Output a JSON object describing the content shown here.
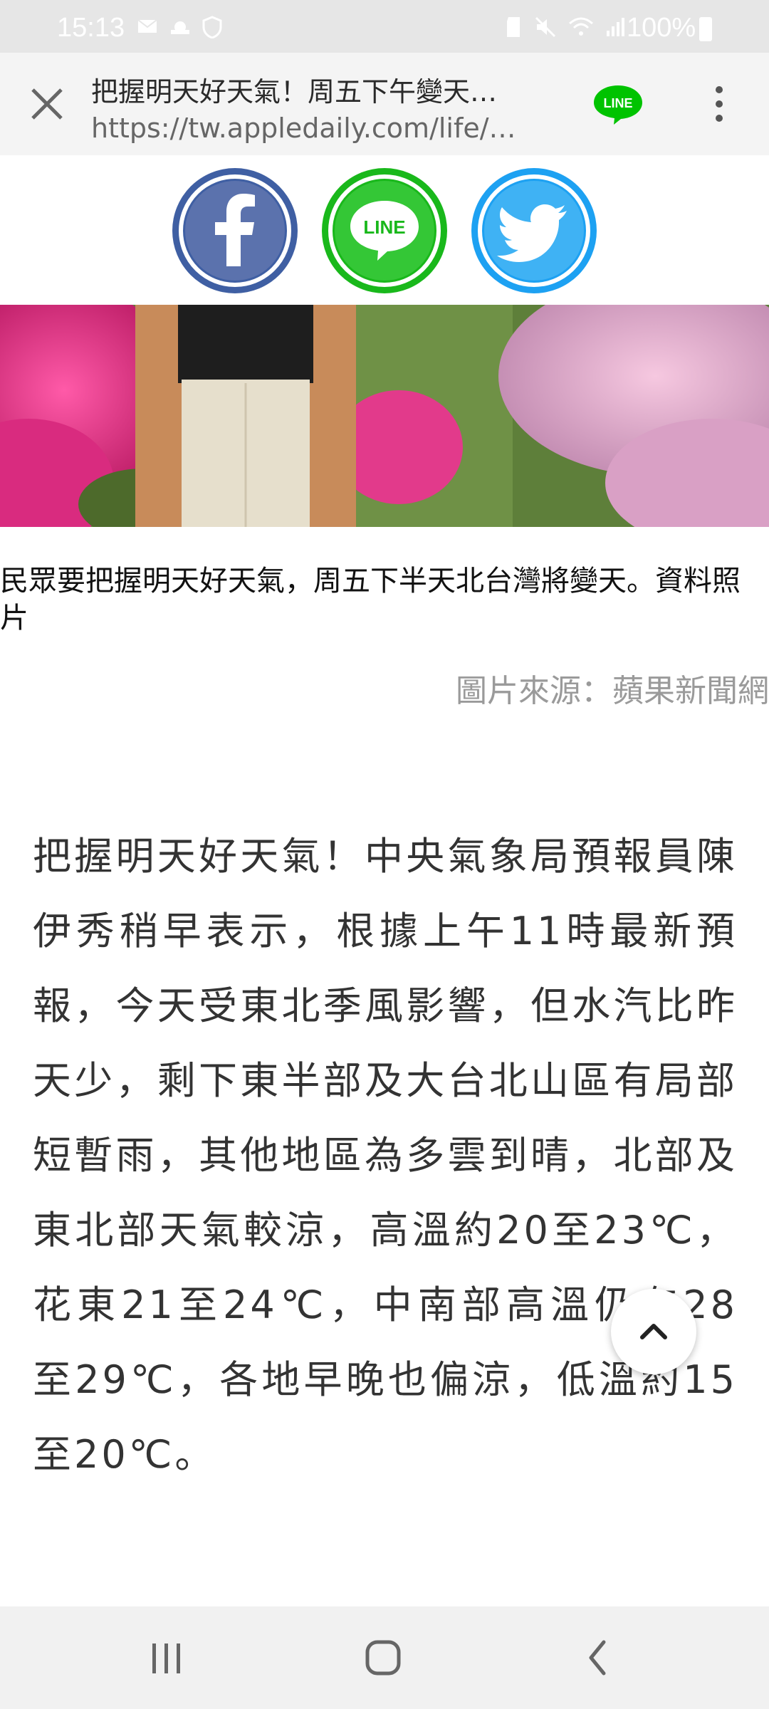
{
  "status_bar": {
    "time": "15:13",
    "battery_percent": "100%",
    "icons_left": [
      "mail-icon",
      "weather-icon",
      "shield-icon"
    ],
    "icons_right": [
      "sd-card-icon",
      "mute-icon",
      "wifi-icon",
      "signal-icon",
      "battery-icon"
    ]
  },
  "browser": {
    "title": "把握明天好天氣！周五下午變天…",
    "url": "https://tw.appledaily.com/life/…",
    "logo_text": "LINE",
    "close_icon": "close-icon",
    "more_icon": "more-vertical-icon"
  },
  "share": {
    "items": [
      {
        "name": "facebook",
        "glyph": "f",
        "color": "#3b5998"
      },
      {
        "name": "line",
        "glyph": "LINE",
        "color": "#00c300"
      },
      {
        "name": "twitter",
        "glyph": "bird",
        "color": "#1da1f2"
      }
    ]
  },
  "photo": {
    "alt_colors": {
      "flowers": "#e0338a",
      "grass": "#5e7f3a",
      "coat": "#c58a5a"
    }
  },
  "caption": {
    "text": "民眾要把握明天好天氣，周五下半天北台灣將變天。資料照片",
    "credit": "圖片來源：蘋果新聞網"
  },
  "article": {
    "paragraph": "把握明天好天氣！中央氣象局預報員陳伊秀稍早表示，根據上午11時最新預報，今天受東北季風影響，但水汽比昨天少，剩下東半部及大台北山區有局部短暫雨，其他地區為多雲到晴，北部及東北部天氣較涼，高溫約20至23℃，花東21至24℃，中南部高溫仍有28至29℃，各地早晚也偏涼，低溫約15至20℃。"
  },
  "nav": {
    "recent_icon": "recent-apps-icon",
    "home_icon": "home-icon",
    "back_icon": "back-icon"
  }
}
